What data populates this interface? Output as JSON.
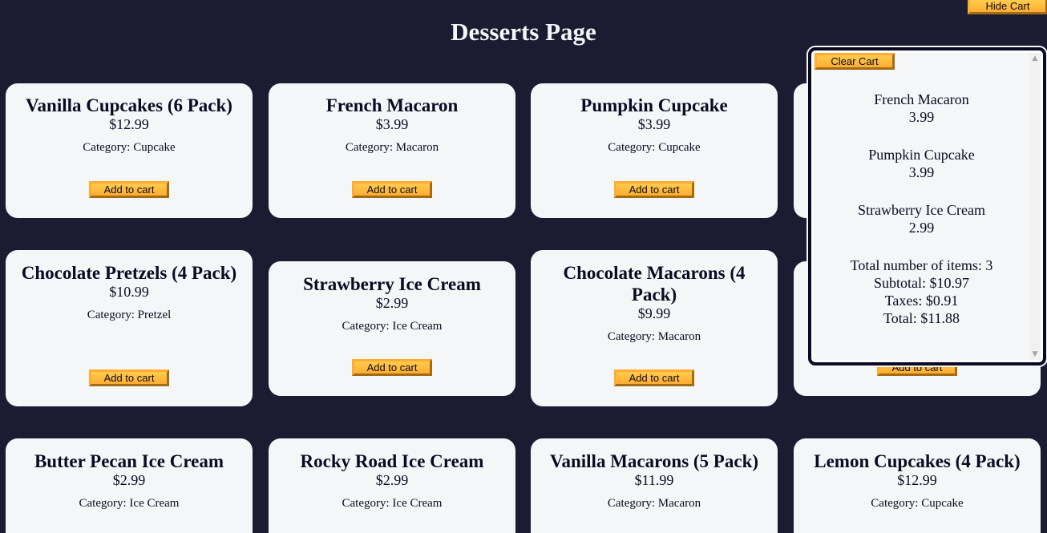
{
  "page": {
    "title": "Desserts Page",
    "hide_cart_label": "Hide Cart",
    "add_to_cart_label": "Add to cart",
    "category_prefix": "Category: "
  },
  "products": [
    {
      "name": "Vanilla Cupcakes (6 Pack)",
      "price": "$12.99",
      "category": "Category: Cupcake"
    },
    {
      "name": "French Macaron",
      "price": "$3.99",
      "category": "Category: Macaron"
    },
    {
      "name": "Pumpkin Cupcake",
      "price": "$3.99",
      "category": "Category: Cupcake"
    },
    {
      "name": "",
      "price": "",
      "category": ""
    },
    {
      "name": "Chocolate Pretzels (4 Pack)",
      "price": "$10.99",
      "category": "Category: Pretzel"
    },
    {
      "name": "Strawberry Ice Cream",
      "price": "$2.99",
      "category": "Category: Ice Cream"
    },
    {
      "name": "Chocolate Macarons (4 Pack)",
      "price": "$9.99",
      "category": "Category: Macaron"
    },
    {
      "name": "",
      "price": "",
      "category": ""
    },
    {
      "name": "Butter Pecan Ice Cream",
      "price": "$2.99",
      "category": "Category: Ice Cream"
    },
    {
      "name": "Rocky Road Ice Cream",
      "price": "$2.99",
      "category": "Category: Ice Cream"
    },
    {
      "name": "Vanilla Macarons (5 Pack)",
      "price": "$11.99",
      "category": "Category: Macaron"
    },
    {
      "name": "Lemon Cupcakes (4 Pack)",
      "price": "$12.99",
      "category": "Category: Cupcake"
    }
  ],
  "cart": {
    "clear_label": "Clear Cart",
    "items": [
      {
        "name": "French Macaron",
        "price": "3.99"
      },
      {
        "name": "Pumpkin Cupcake",
        "price": "3.99"
      },
      {
        "name": "Strawberry Ice Cream",
        "price": "2.99"
      }
    ],
    "total_items": "Total number of items: 3",
    "subtotal": "Subtotal: $10.97",
    "taxes": "Taxes: $0.91",
    "total": "Total: $11.88"
  },
  "colors": {
    "background": "#1b1b32",
    "card": "#f5f6f7",
    "button": "#feac32",
    "text": "#0a0a23"
  }
}
